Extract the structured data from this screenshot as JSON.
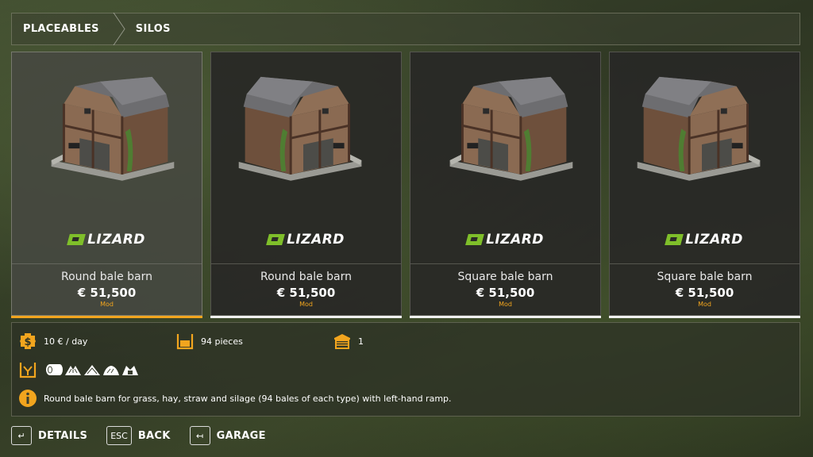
{
  "breadcrumb": {
    "items": [
      "PLACEABLES",
      "SILOS"
    ]
  },
  "cards": [
    {
      "name": "Round bale barn",
      "price": "€ 51,500",
      "tag": "Mod",
      "logo": "LIZARD",
      "selected": true,
      "variant": "left-ramp"
    },
    {
      "name": "Round bale barn",
      "price": "€ 51,500",
      "tag": "Mod",
      "logo": "LIZARD",
      "selected": false,
      "variant": "right-ramp"
    },
    {
      "name": "Square bale barn",
      "price": "€ 51,500",
      "tag": "Mod",
      "logo": "LIZARD",
      "selected": false,
      "variant": "left-ramp"
    },
    {
      "name": "Square bale barn",
      "price": "€ 51,500",
      "tag": "Mod",
      "logo": "LIZARD",
      "selected": false,
      "variant": "right-ramp"
    }
  ],
  "details": {
    "upkeep": "10 € / day",
    "capacity": "94 pieces",
    "count": "1",
    "description": "Round bale barn for grass, hay, straw and silage (94 bales of each type) with left-hand ramp.",
    "icons": [
      "upkeep-coin-icon",
      "capacity-box-icon",
      "shed-icon",
      "fill-type-icon",
      "info-icon"
    ],
    "fill_types": [
      "round-bale-icon",
      "grass-icon",
      "hay-icon",
      "straw-icon",
      "silage-icon"
    ]
  },
  "controls": [
    {
      "key": "↵",
      "label": "DETAILS"
    },
    {
      "key": "ESC",
      "label": "BACK"
    },
    {
      "key": "↤",
      "label": "GARAGE"
    }
  ],
  "colors": {
    "accent": "#f2a51e",
    "logo_green": "#7fbf2a"
  }
}
